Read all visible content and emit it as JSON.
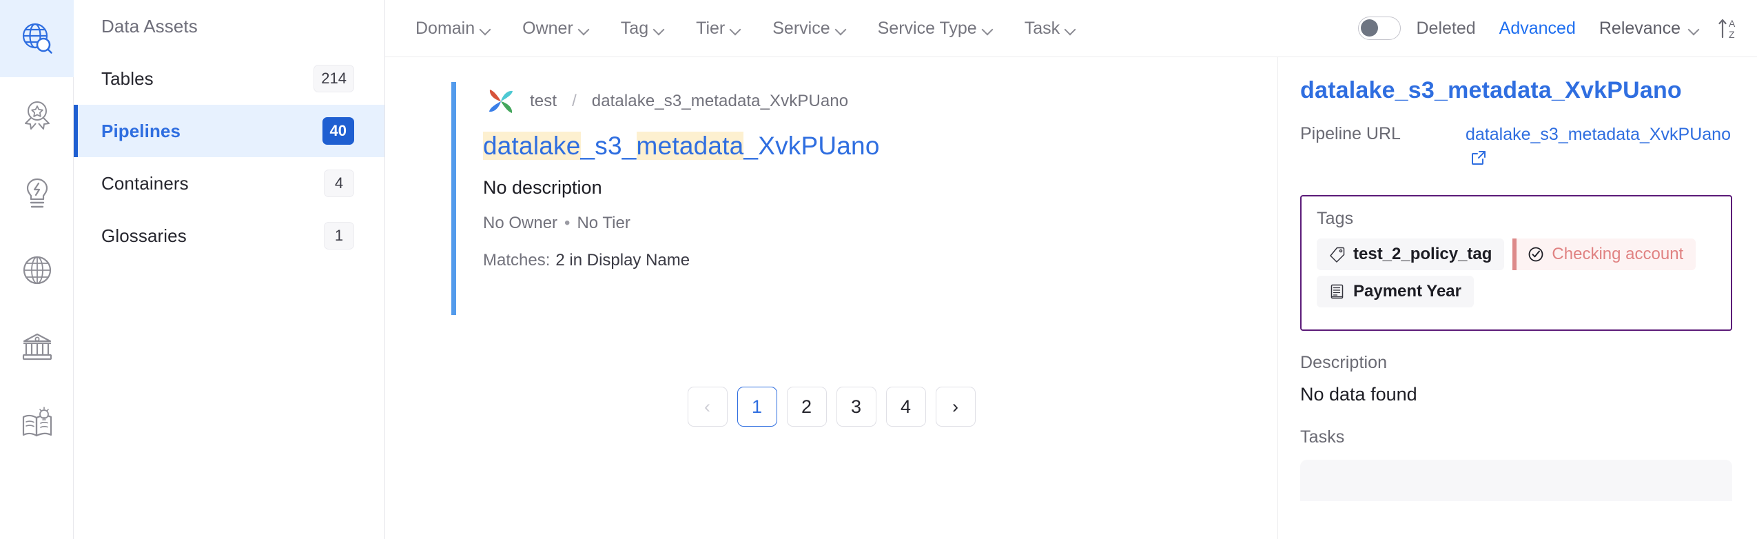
{
  "icon_rail": {
    "items": [
      {
        "name": "explore-globe-search-icon",
        "active": true
      },
      {
        "name": "quality-ribbon-icon",
        "active": false
      },
      {
        "name": "insights-bulb-icon",
        "active": false
      },
      {
        "name": "domains-globe-icon",
        "active": false
      },
      {
        "name": "governance-bank-icon",
        "active": false
      },
      {
        "name": "glossary-book-icon",
        "active": false
      }
    ]
  },
  "sidebar": {
    "header": "Data Assets",
    "items": [
      {
        "label": "Tables",
        "count": "214",
        "active": false
      },
      {
        "label": "Pipelines",
        "count": "40",
        "active": true
      },
      {
        "label": "Containers",
        "count": "4",
        "active": false
      },
      {
        "label": "Glossaries",
        "count": "1",
        "active": false
      }
    ]
  },
  "toolbar": {
    "filters": [
      {
        "label": "Domain"
      },
      {
        "label": "Owner"
      },
      {
        "label": "Tag"
      },
      {
        "label": "Tier"
      },
      {
        "label": "Service"
      },
      {
        "label": "Service Type"
      },
      {
        "label": "Task"
      }
    ],
    "deleted_toggle": {
      "label": "Deleted",
      "on": false
    },
    "advanced_label": "Advanced",
    "sort_select": "Relevance",
    "sort_order_icon": "sort-az-ascending-icon"
  },
  "results": {
    "card": {
      "service_icon": "airflow-pinwheel-icon",
      "breadcrumb_service": "test",
      "breadcrumb_separator": "/",
      "breadcrumb_name": "datalake_s3_metadata_XvkPUano",
      "title_parts": [
        {
          "text": "datalake",
          "highlight": true
        },
        {
          "text": "_s3_",
          "highlight": false
        },
        {
          "text": "metadata",
          "highlight": true
        },
        {
          "text": "_XvkPUano",
          "highlight": false
        }
      ],
      "description": "No description",
      "owner": "No Owner",
      "owner_separator": "•",
      "tier": "No Tier",
      "matches_label": "Matches:",
      "matches_value": "2 in Display Name"
    },
    "pagination": {
      "prev": "‹",
      "pages": [
        "1",
        "2",
        "3",
        "4"
      ],
      "active_page": "1",
      "next": "›"
    }
  },
  "detail": {
    "title": "datalake_s3_metadata_XvkPUano",
    "pipeline_url_label": "Pipeline URL",
    "pipeline_url_value": "datalake_s3_metadata_XvkPUano",
    "external_link_icon": "external-link-icon",
    "tags": {
      "label": "Tags",
      "items": [
        {
          "text": "test_2_policy_tag",
          "icon": "tag-icon",
          "style": "default"
        },
        {
          "text": "Checking account",
          "icon": "check-circle-icon",
          "style": "alert"
        },
        {
          "text": "Payment Year",
          "icon": "glossary-term-icon",
          "style": "default"
        }
      ]
    },
    "description": {
      "label": "Description",
      "value": "No data found"
    },
    "tasks": {
      "label": "Tasks"
    }
  },
  "colors": {
    "accent_blue": "#2f6ee0",
    "active_bg": "#e7f1fe",
    "highlight_yellow": "#fdf0d0",
    "tags_box_border": "#5b1a78",
    "alert_red": "#e08282",
    "card_bar_blue": "#539bec"
  }
}
